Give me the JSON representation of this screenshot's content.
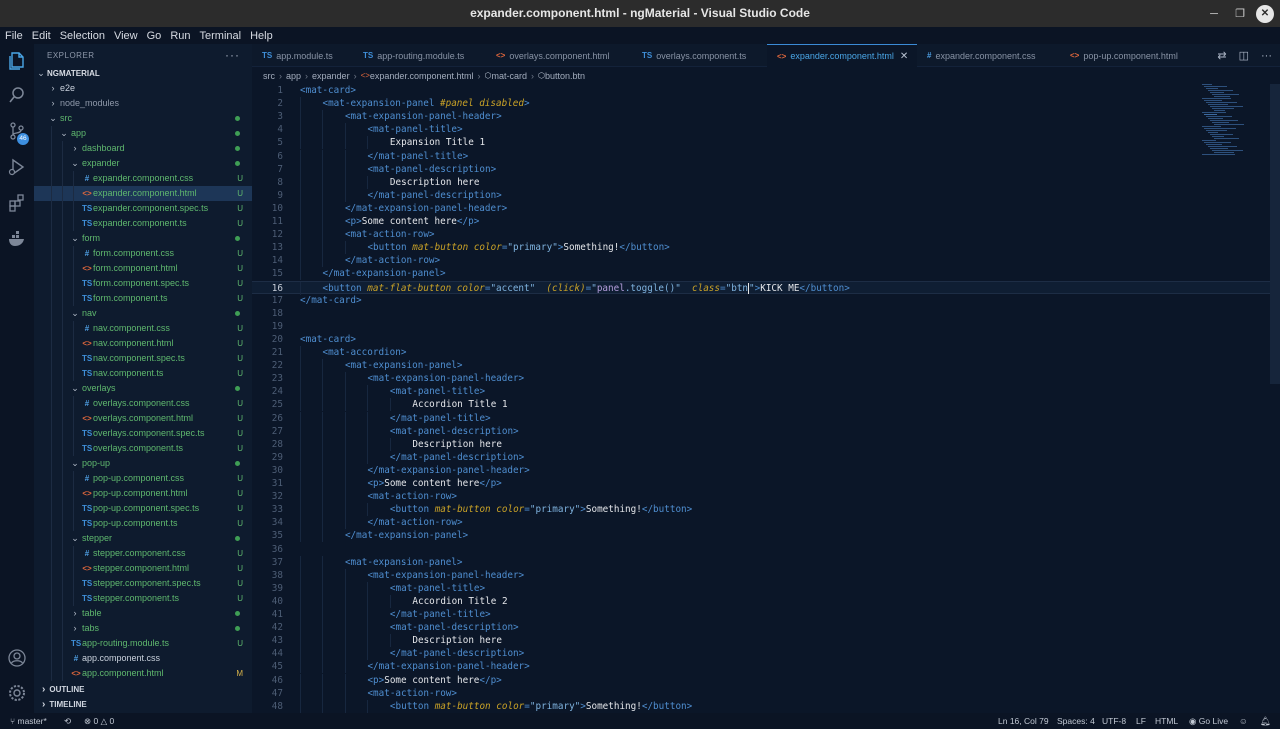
{
  "window": {
    "title": "expander.component.html - ngMaterial - Visual Studio Code"
  },
  "menu": [
    "File",
    "Edit",
    "Selection",
    "View",
    "Go",
    "Run",
    "Terminal",
    "Help"
  ],
  "activity": {
    "source_control_count": "46"
  },
  "explorer": {
    "header": "EXPLORER",
    "more": "···",
    "root": "NGMATERIAL",
    "rows": [
      {
        "name": "e2e",
        "indent": 0,
        "twisty": "›",
        "type": "folder",
        "color": "#c9d1dc"
      },
      {
        "name": "node_modules",
        "indent": 0,
        "twisty": "›",
        "type": "folder",
        "color": "#8f99aa"
      },
      {
        "name": "src",
        "indent": 0,
        "twisty": "⌄",
        "type": "folder",
        "color": "#5fb86e",
        "dot": true
      },
      {
        "name": "app",
        "indent": 1,
        "twisty": "⌄",
        "type": "folder",
        "color": "#5fb86e",
        "dot": true
      },
      {
        "name": "dashboard",
        "indent": 2,
        "twisty": "›",
        "type": "folder",
        "color": "#5fb86e",
        "dot": true
      },
      {
        "name": "expander",
        "indent": 2,
        "twisty": "⌄",
        "type": "folder",
        "color": "#5fb86e",
        "dot": true
      },
      {
        "name": "expander.component.css",
        "indent": 3,
        "type": "css",
        "color": "#5fb86e",
        "badge": "U"
      },
      {
        "name": "expander.component.html",
        "indent": 3,
        "type": "html",
        "color": "#5fb86e",
        "badge": "U",
        "selected": true
      },
      {
        "name": "expander.component.spec.ts",
        "indent": 3,
        "type": "ts",
        "color": "#5fb86e",
        "badge": "U"
      },
      {
        "name": "expander.component.ts",
        "indent": 3,
        "type": "ts",
        "color": "#5fb86e",
        "badge": "U"
      },
      {
        "name": "form",
        "indent": 2,
        "twisty": "⌄",
        "type": "folder",
        "color": "#5fb86e",
        "dot": true
      },
      {
        "name": "form.component.css",
        "indent": 3,
        "type": "css",
        "color": "#5fb86e",
        "badge": "U"
      },
      {
        "name": "form.component.html",
        "indent": 3,
        "type": "html",
        "color": "#5fb86e",
        "badge": "U"
      },
      {
        "name": "form.component.spec.ts",
        "indent": 3,
        "type": "ts",
        "color": "#5fb86e",
        "badge": "U"
      },
      {
        "name": "form.component.ts",
        "indent": 3,
        "type": "ts",
        "color": "#5fb86e",
        "badge": "U"
      },
      {
        "name": "nav",
        "indent": 2,
        "twisty": "⌄",
        "type": "folder",
        "color": "#5fb86e",
        "dot": true
      },
      {
        "name": "nav.component.css",
        "indent": 3,
        "type": "css",
        "color": "#5fb86e",
        "badge": "U"
      },
      {
        "name": "nav.component.html",
        "indent": 3,
        "type": "html",
        "color": "#5fb86e",
        "badge": "U"
      },
      {
        "name": "nav.component.spec.ts",
        "indent": 3,
        "type": "ts",
        "color": "#5fb86e",
        "badge": "U"
      },
      {
        "name": "nav.component.ts",
        "indent": 3,
        "type": "ts",
        "color": "#5fb86e",
        "badge": "U"
      },
      {
        "name": "overlays",
        "indent": 2,
        "twisty": "⌄",
        "type": "folder",
        "color": "#5fb86e",
        "dot": true
      },
      {
        "name": "overlays.component.css",
        "indent": 3,
        "type": "css",
        "color": "#5fb86e",
        "badge": "U"
      },
      {
        "name": "overlays.component.html",
        "indent": 3,
        "type": "html",
        "color": "#5fb86e",
        "badge": "U"
      },
      {
        "name": "overlays.component.spec.ts",
        "indent": 3,
        "type": "ts",
        "color": "#5fb86e",
        "badge": "U"
      },
      {
        "name": "overlays.component.ts",
        "indent": 3,
        "type": "ts",
        "color": "#5fb86e",
        "badge": "U"
      },
      {
        "name": "pop-up",
        "indent": 2,
        "twisty": "⌄",
        "type": "folder",
        "color": "#5fb86e",
        "dot": true
      },
      {
        "name": "pop-up.component.css",
        "indent": 3,
        "type": "css",
        "color": "#5fb86e",
        "badge": "U"
      },
      {
        "name": "pop-up.component.html",
        "indent": 3,
        "type": "html",
        "color": "#5fb86e",
        "badge": "U"
      },
      {
        "name": "pop-up.component.spec.ts",
        "indent": 3,
        "type": "ts",
        "color": "#5fb86e",
        "badge": "U"
      },
      {
        "name": "pop-up.component.ts",
        "indent": 3,
        "type": "ts",
        "color": "#5fb86e",
        "badge": "U"
      },
      {
        "name": "stepper",
        "indent": 2,
        "twisty": "⌄",
        "type": "folder",
        "color": "#5fb86e",
        "dot": true
      },
      {
        "name": "stepper.component.css",
        "indent": 3,
        "type": "css",
        "color": "#5fb86e",
        "badge": "U"
      },
      {
        "name": "stepper.component.html",
        "indent": 3,
        "type": "html",
        "color": "#5fb86e",
        "badge": "U"
      },
      {
        "name": "stepper.component.spec.ts",
        "indent": 3,
        "type": "ts",
        "color": "#5fb86e",
        "badge": "U"
      },
      {
        "name": "stepper.component.ts",
        "indent": 3,
        "type": "ts",
        "color": "#5fb86e",
        "badge": "U"
      },
      {
        "name": "table",
        "indent": 2,
        "twisty": "›",
        "type": "folder",
        "color": "#5fb86e",
        "dot": true
      },
      {
        "name": "tabs",
        "indent": 2,
        "twisty": "›",
        "type": "folder",
        "color": "#5fb86e",
        "dot": true
      },
      {
        "name": "app-routing.module.ts",
        "indent": 2,
        "type": "ts",
        "color": "#5fb86e",
        "badge": "U"
      },
      {
        "name": "app.component.css",
        "indent": 2,
        "type": "css",
        "color": "#c9d1dc"
      },
      {
        "name": "app.component.html",
        "indent": 2,
        "type": "html",
        "color": "#5fb86e",
        "badge": "M"
      }
    ],
    "sections": [
      "OUTLINE",
      "TIMELINE"
    ]
  },
  "tabs": [
    {
      "label": "app.module.ts",
      "type": "ts"
    },
    {
      "label": "app-routing.module.ts",
      "type": "ts"
    },
    {
      "label": "overlays.component.html",
      "type": "html"
    },
    {
      "label": "overlays.component.ts",
      "type": "ts"
    },
    {
      "label": "expander.component.html",
      "type": "html",
      "active": true
    },
    {
      "label": "expander.component.css",
      "type": "css"
    },
    {
      "label": "pop-up.component.html",
      "type": "html"
    }
  ],
  "breadcrumb": [
    "src",
    "app",
    "expander",
    "expander.component.html",
    "mat-card",
    "button.btn"
  ],
  "editor": {
    "cursor_line": 16,
    "lines": [
      {
        "n": "1",
        "d": 0,
        "t": [
          [
            "tg",
            "<mat-card>"
          ]
        ]
      },
      {
        "n": "2",
        "d": 1,
        "t": [
          [
            "tg",
            "<mat-expansion-panel "
          ],
          [
            "at",
            "#panel disabled"
          ],
          [
            "tg",
            ">"
          ]
        ]
      },
      {
        "n": "3",
        "d": 2,
        "t": [
          [
            "tg",
            "<mat-expansion-panel-header>"
          ]
        ]
      },
      {
        "n": "4",
        "d": 3,
        "t": [
          [
            "tg",
            "<mat-panel-title>"
          ]
        ]
      },
      {
        "n": "5",
        "d": 4,
        "t": [
          [
            "tx",
            "Expansion Title 1"
          ]
        ]
      },
      {
        "n": "6",
        "d": 3,
        "t": [
          [
            "tg",
            "</mat-panel-title>"
          ]
        ]
      },
      {
        "n": "7",
        "d": 3,
        "t": [
          [
            "tg",
            "<mat-panel-description>"
          ]
        ]
      },
      {
        "n": "8",
        "d": 4,
        "t": [
          [
            "tx",
            "Description here"
          ]
        ]
      },
      {
        "n": "9",
        "d": 3,
        "t": [
          [
            "tg",
            "</mat-panel-description>"
          ]
        ]
      },
      {
        "n": "10",
        "d": 2,
        "t": [
          [
            "tg",
            "</mat-expansion-panel-header>"
          ]
        ]
      },
      {
        "n": "11",
        "d": 2,
        "t": [
          [
            "tg",
            "<p>"
          ],
          [
            "tx",
            "Some content here"
          ],
          [
            "tg",
            "</p>"
          ]
        ]
      },
      {
        "n": "12",
        "d": 2,
        "t": [
          [
            "tg",
            "<mat-action-row>"
          ]
        ]
      },
      {
        "n": "13",
        "d": 3,
        "t": [
          [
            "tg",
            "<button "
          ],
          [
            "at",
            "mat-button"
          ],
          [
            "tg",
            " "
          ],
          [
            "at",
            "color"
          ],
          [
            "tg",
            "="
          ],
          [
            "sv",
            "\"primary\""
          ],
          [
            "tg",
            ">"
          ],
          [
            "tx",
            "Something!"
          ],
          [
            "tg",
            "</button>"
          ]
        ]
      },
      {
        "n": "14",
        "d": 2,
        "t": [
          [
            "tg",
            "</mat-action-row>"
          ]
        ]
      },
      {
        "n": "15",
        "d": 1,
        "t": [
          [
            "tg",
            "</mat-expansion-panel>"
          ]
        ]
      },
      {
        "n": "16",
        "d": 1,
        "t": [
          [
            "tg",
            "<button "
          ],
          [
            "at",
            "mat-flat-button"
          ],
          [
            "tg",
            " "
          ],
          [
            "at",
            "color"
          ],
          [
            "tg",
            "="
          ],
          [
            "sv",
            "\"accent\""
          ],
          [
            "tg",
            "  "
          ],
          [
            "at",
            "(click)"
          ],
          [
            "tg",
            "="
          ],
          [
            "sv",
            "\""
          ],
          [
            "pn",
            "panel"
          ],
          [
            "sv",
            ".toggle()\""
          ],
          [
            "tg",
            "  "
          ],
          [
            "at",
            "class"
          ],
          [
            "tg",
            "="
          ],
          [
            "sv",
            "\"btn"
          ],
          [
            "caret",
            ""
          ],
          [
            "sv",
            "\""
          ],
          [
            "tg",
            ">"
          ],
          [
            "tx",
            "KICK ME"
          ],
          [
            "tg",
            "</button>"
          ]
        ]
      },
      {
        "n": "17",
        "d": 0,
        "t": [
          [
            "tg",
            "</mat-card>"
          ]
        ]
      },
      {
        "n": "18",
        "d": 0,
        "t": []
      },
      {
        "n": "19",
        "d": 0,
        "t": []
      },
      {
        "n": "20",
        "d": 0,
        "t": [
          [
            "tg",
            "<mat-card>"
          ]
        ]
      },
      {
        "n": "21",
        "d": 1,
        "t": [
          [
            "tg",
            "<mat-accordion>"
          ]
        ]
      },
      {
        "n": "22",
        "d": 2,
        "t": [
          [
            "tg",
            "<mat-expansion-panel>"
          ]
        ]
      },
      {
        "n": "23",
        "d": 3,
        "t": [
          [
            "tg",
            "<mat-expansion-panel-header>"
          ]
        ]
      },
      {
        "n": "24",
        "d": 4,
        "t": [
          [
            "tg",
            "<mat-panel-title>"
          ]
        ]
      },
      {
        "n": "25",
        "d": 5,
        "t": [
          [
            "tx",
            "Accordion Title 1"
          ]
        ]
      },
      {
        "n": "26",
        "d": 4,
        "t": [
          [
            "tg",
            "</mat-panel-title>"
          ]
        ]
      },
      {
        "n": "27",
        "d": 4,
        "t": [
          [
            "tg",
            "<mat-panel-description>"
          ]
        ]
      },
      {
        "n": "28",
        "d": 5,
        "t": [
          [
            "tx",
            "Description here"
          ]
        ]
      },
      {
        "n": "29",
        "d": 4,
        "t": [
          [
            "tg",
            "</mat-panel-description>"
          ]
        ]
      },
      {
        "n": "30",
        "d": 3,
        "t": [
          [
            "tg",
            "</mat-expansion-panel-header>"
          ]
        ]
      },
      {
        "n": "31",
        "d": 3,
        "t": [
          [
            "tg",
            "<p>"
          ],
          [
            "tx",
            "Some content here"
          ],
          [
            "tg",
            "</p>"
          ]
        ]
      },
      {
        "n": "32",
        "d": 3,
        "t": [
          [
            "tg",
            "<mat-action-row>"
          ]
        ]
      },
      {
        "n": "33",
        "d": 4,
        "t": [
          [
            "tg",
            "<button "
          ],
          [
            "at",
            "mat-button"
          ],
          [
            "tg",
            " "
          ],
          [
            "at",
            "color"
          ],
          [
            "tg",
            "="
          ],
          [
            "sv",
            "\"primary\""
          ],
          [
            "tg",
            ">"
          ],
          [
            "tx",
            "Something!"
          ],
          [
            "tg",
            "</button>"
          ]
        ]
      },
      {
        "n": "34",
        "d": 3,
        "t": [
          [
            "tg",
            "</mat-action-row>"
          ]
        ]
      },
      {
        "n": "35",
        "d": 2,
        "t": [
          [
            "tg",
            "</mat-expansion-panel>"
          ]
        ]
      },
      {
        "n": "36",
        "d": 0,
        "t": []
      },
      {
        "n": "37",
        "d": 2,
        "t": [
          [
            "tg",
            "<mat-expansion-panel>"
          ]
        ]
      },
      {
        "n": "38",
        "d": 3,
        "t": [
          [
            "tg",
            "<mat-expansion-panel-header>"
          ]
        ]
      },
      {
        "n": "39",
        "d": 4,
        "t": [
          [
            "tg",
            "<mat-panel-title>"
          ]
        ]
      },
      {
        "n": "40",
        "d": 5,
        "t": [
          [
            "tx",
            "Accordion Title 2"
          ]
        ]
      },
      {
        "n": "41",
        "d": 4,
        "t": [
          [
            "tg",
            "</mat-panel-title>"
          ]
        ]
      },
      {
        "n": "42",
        "d": 4,
        "t": [
          [
            "tg",
            "<mat-panel-description>"
          ]
        ]
      },
      {
        "n": "43",
        "d": 5,
        "t": [
          [
            "tx",
            "Description here"
          ]
        ]
      },
      {
        "n": "44",
        "d": 4,
        "t": [
          [
            "tg",
            "</mat-panel-description>"
          ]
        ]
      },
      {
        "n": "45",
        "d": 3,
        "t": [
          [
            "tg",
            "</mat-expansion-panel-header>"
          ]
        ]
      },
      {
        "n": "46",
        "d": 3,
        "t": [
          [
            "tg",
            "<p>"
          ],
          [
            "tx",
            "Some content here"
          ],
          [
            "tg",
            "</p>"
          ]
        ]
      },
      {
        "n": "47",
        "d": 3,
        "t": [
          [
            "tg",
            "<mat-action-row>"
          ]
        ]
      },
      {
        "n": "48",
        "d": 4,
        "t": [
          [
            "tg",
            "<button "
          ],
          [
            "at",
            "mat-button"
          ],
          [
            "tg",
            " "
          ],
          [
            "at",
            "color"
          ],
          [
            "tg",
            "="
          ],
          [
            "sv",
            "\"primary\""
          ],
          [
            "tg",
            ">"
          ],
          [
            "tx",
            "Something!"
          ],
          [
            "tg",
            "</button>"
          ]
        ]
      }
    ]
  },
  "status": {
    "branch": "master*",
    "errors": "0",
    "warnings": "0",
    "position": "Ln 16, Col 79",
    "spaces": "Spaces: 4",
    "encoding": "UTF-8",
    "eol": "LF",
    "language": "HTML",
    "golive": "Go Live"
  },
  "colors": {
    "tag": "#4f8ed0",
    "attr": "#c9a227",
    "string": "#7fb3df",
    "text": "#e4e6ea",
    "accent": "#3b8bd6",
    "git_added": "#5fb86e"
  }
}
